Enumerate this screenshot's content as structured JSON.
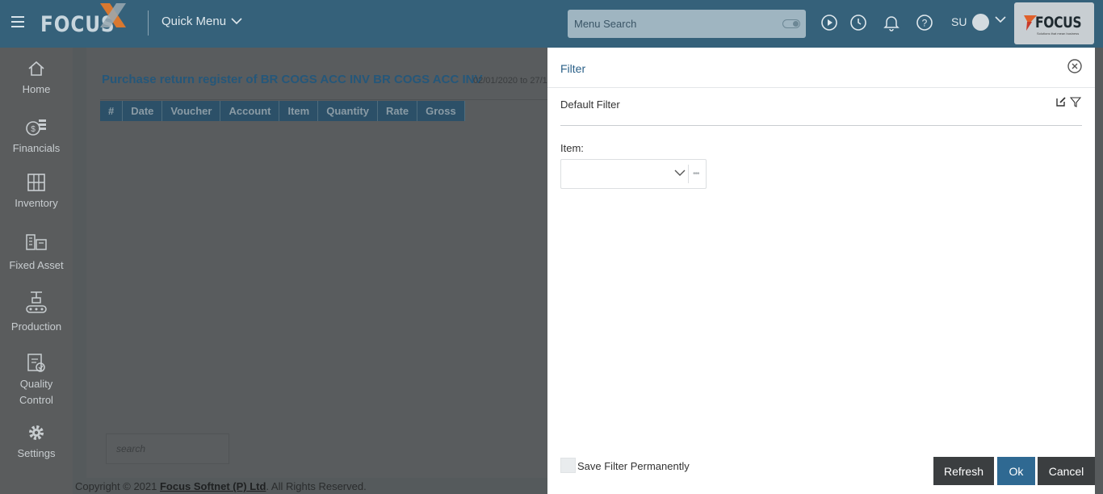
{
  "topbar": {
    "logo_text": "FOCUS",
    "quick_menu_label": "Quick Menu",
    "search_placeholder": "Menu Search",
    "user_initials": "SU",
    "brand_text": "FOCUS",
    "brand_tagline": "Solutions that mean business"
  },
  "sidebar": {
    "items": [
      {
        "label": "Home",
        "icon": "home-icon"
      },
      {
        "label": "Financials",
        "icon": "financials-icon"
      },
      {
        "label": "Inventory",
        "icon": "inventory-icon"
      },
      {
        "label": "Fixed Asset",
        "icon": "fixed-asset-icon"
      },
      {
        "label": "Production",
        "icon": "production-icon"
      },
      {
        "label": "Quality Control",
        "icon": "quality-control-icon"
      },
      {
        "label": "Settings",
        "icon": "settings-icon"
      }
    ]
  },
  "report": {
    "title": "Purchase return register of BR COGS ACC INV BR COGS ACC INV",
    "date_range": "02/01/2020 to 27/1",
    "columns": [
      "#",
      "Date",
      "Voucher",
      "Account",
      "Item",
      "Quantity",
      "Rate",
      "Gross"
    ],
    "search_placeholder": "search"
  },
  "footer": {
    "prefix": "Copyright © 2021 ",
    "company": "Focus Softnet (P) Ltd",
    "suffix": ". All Rights Reserved."
  },
  "filter_panel": {
    "title": "Filter",
    "default_filter_label": "Default Filter",
    "item_label": "Item:",
    "item_value": "",
    "save_filter_label": "Save Filter Permanently",
    "save_filter_checked": false,
    "buttons": {
      "refresh": "Refresh",
      "ok": "Ok",
      "cancel": "Cancel"
    }
  },
  "colors": {
    "topbar": "#35617a",
    "accent": "#2f6992",
    "dark_button": "#3b3e40",
    "logo_x_orange": "#d9782f"
  }
}
